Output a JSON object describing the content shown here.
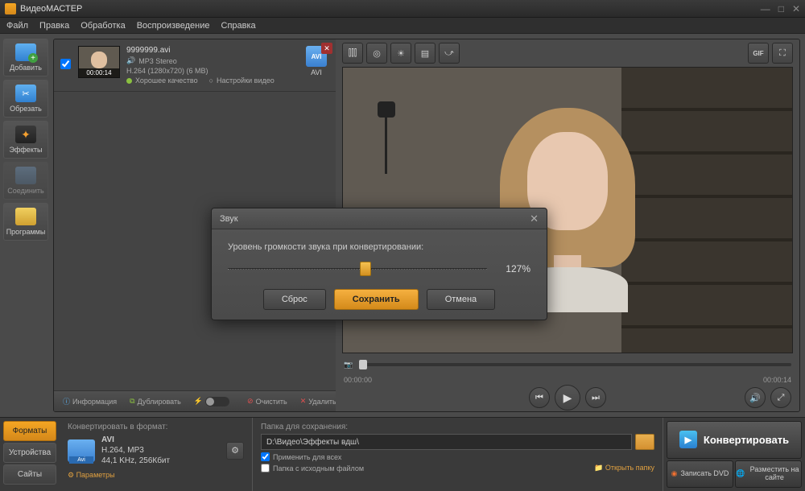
{
  "titlebar": {
    "title": "ВидеоМАСТЕР"
  },
  "menu": {
    "file": "Файл",
    "edit": "Правка",
    "process": "Обработка",
    "playback": "Воспроизведение",
    "help": "Справка"
  },
  "sidebar": {
    "add": "Добавить",
    "crop": "Обрезать",
    "effects": "Эффекты",
    "join": "Соединить",
    "programs": "Программы"
  },
  "file": {
    "name": "9999999.avi",
    "audio": "MP3 Stereo",
    "video": "H.264 (1280x720) (6 MB)",
    "duration": "00:00:14",
    "quality": "Хорошее качество",
    "settings": "Настройки видео",
    "format": "AVI",
    "fmt_small": "AVI"
  },
  "filebar": {
    "info": "Информация",
    "duplicate": "Дублировать",
    "clear": "Очистить",
    "delete": "Удалить"
  },
  "timeline": {
    "start": "00:00:00",
    "end": "00:00:14"
  },
  "toolbar": {
    "gif": "GIF"
  },
  "bottom": {
    "tabs": {
      "formats": "Форматы",
      "devices": "Устройства",
      "sites": "Сайты"
    },
    "convert_to": "Конвертировать в формат:",
    "fmt_name": "AVI",
    "fmt_badge": "Avi",
    "fmt_detail1": "H.264, MP3",
    "fmt_detail2": "44,1 KHz, 256Кбит",
    "params": "Параметры",
    "save_folder": "Папка для сохранения:",
    "path": "D:\\Видео\\Эффекты вдш\\",
    "apply_all": "Применить для всех",
    "same_folder": "Папка с исходным файлом",
    "open_folder": "Открыть папку",
    "convert": "Конвертировать",
    "burn": "Записать DVD",
    "upload": "Разместить на сайте"
  },
  "dialog": {
    "title": "Звук",
    "label": "Уровень громкости звука при конвертировании:",
    "value": "127%",
    "reset": "Сброс",
    "save": "Сохранить",
    "cancel": "Отмена"
  }
}
